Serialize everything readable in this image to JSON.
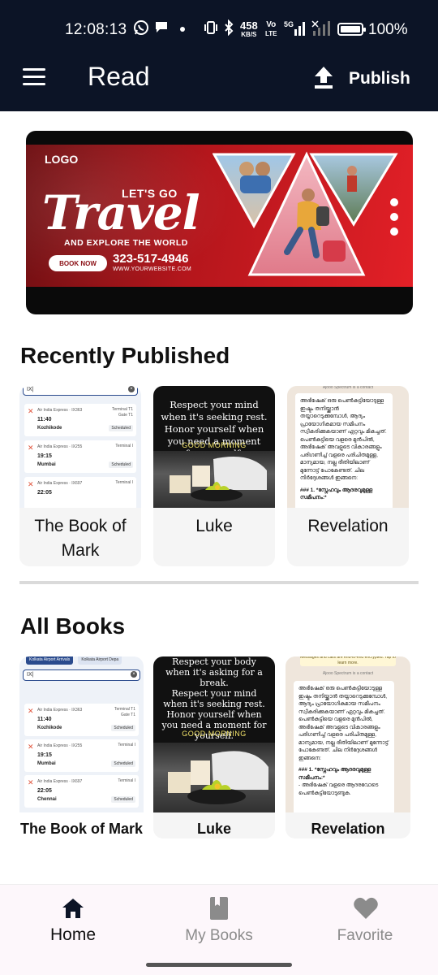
{
  "status_bar": {
    "time": "12:08:13",
    "network_speed_value": "458",
    "network_speed_unit": "KB/S",
    "volte_top": "Vo",
    "volte_bottom": "LTE",
    "signal_label": "5G",
    "battery_percent": "100%",
    "battery_level": 1.0,
    "icons": [
      "whatsapp-icon",
      "chat-bubble-icon",
      "dot-icon",
      "vibrate-icon",
      "bluetooth-icon",
      "signal-icon",
      "signal-icon-2",
      "battery-icon"
    ]
  },
  "app_bar": {
    "title": "Read",
    "publish_label": "Publish",
    "icons": [
      "menu-icon",
      "upload-icon"
    ]
  },
  "banner": {
    "logo": "LOGO",
    "tagline_top": "LET'S GO",
    "headline": "Travel",
    "subline": "AND EXPLORE THE WORLD",
    "cta": "BOOK NOW",
    "phone": "323-517-4946",
    "website": "WWW.YOURWEBSITE.COM",
    "colors": {
      "primary": "#b5161c",
      "accent": "#e32027",
      "dark": "#0a0a0a"
    }
  },
  "recently_published": {
    "title": "Recently Published",
    "books": [
      {
        "name_line1": "The Book of",
        "name_line2": "Mark",
        "thumbnail": "flight-list"
      },
      {
        "name_line1": "Luke",
        "thumbnail": "spa-quote"
      },
      {
        "name_line1": "Revelation",
        "thumbnail": "malayalam-chat"
      }
    ]
  },
  "all_books": {
    "title": "All Books",
    "books": [
      {
        "name": "The Book of Mark",
        "thumbnail": "flight-list"
      },
      {
        "name": "Luke",
        "thumbnail": "spa-quote"
      },
      {
        "name": "Revelation",
        "thumbnail": "malayalam-chat"
      }
    ]
  },
  "thumb_flight": {
    "tabs": [
      "Kolkata Airport Arrivals",
      "Kolkata Airport Depa"
    ],
    "search_value": "IX|",
    "flights": [
      {
        "airline": "Air India Express · IX363",
        "terminal": "Terminal T1\nGate T1",
        "time": "11:40",
        "city": "Kozhikode",
        "status": "Scheduled"
      },
      {
        "airline": "Air India Express · IX255",
        "terminal": "Terminal I",
        "time": "19:15",
        "city": "Mumbai",
        "status": "Scheduled"
      },
      {
        "airline": "Air India Express · IX697",
        "terminal": "Terminal I",
        "time": "22:05",
        "city": "Chennai",
        "status": "Scheduled"
      }
    ]
  },
  "thumb_spa": {
    "quote_top": "Respect your body when it's asking for a break.",
    "quote": "Respect your mind when it's seeking rest. Honor yourself when you need a moment for yourself.",
    "greeting": "GOOD MORNING"
  },
  "thumb_chat": {
    "note": "Messages and calls are end-to-end encrypted. Tap to learn more.",
    "header": "Ajooo Spectrum is a contact",
    "body": "അഭിഷേക് ഒരു പെൺകുട്ടിയോടുള്ള ഇഷ്ടം തനിയ്ക്കാൻ തയ്യാറെടുക്കുമ്പോൾ, ആദ്യം പ്രായോഗികമായ സമീപനം സ്വീകരിക്കുകയാണ് ഏറ്റവും മികച്ചത്. പെൺകുട്ടിയെ വളരെ മുൻപിൽ, അഭിഷേക് അവളുടെ വികാരങ്ങളും പരിഗണിച്ച് വളരെ പരിചിതമുള്ള, മാന്യമായ, നല്ല രീതിയിലാണ് മുന്നോട്ട് പോകേണ്ടത്. ചില നിർദ്ദേശങ്ങൾ ഇങ്ങനെ:",
    "heading": "### 1. *സ്നേഹവും ആദരവുമുള്ള സമീപനം:*",
    "bullet": "- അഭിഷേക് വളരെ ആദരവോടെ പെൺകുട്ടിയോടുണ്ടുക."
  },
  "bottom_nav": {
    "items": [
      {
        "label": "Home",
        "icon": "home-icon",
        "active": true
      },
      {
        "label": "My Books",
        "icon": "book-icon",
        "active": false
      },
      {
        "label": "Favorite",
        "icon": "heart-icon",
        "active": false
      }
    ]
  }
}
